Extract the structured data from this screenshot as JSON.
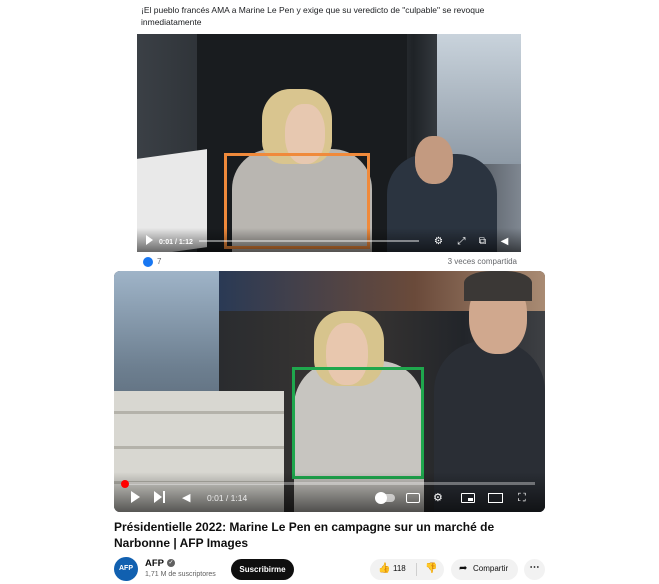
{
  "post": {
    "text": "¡El pueblo francés AMA a Marine Le Pen y exige que su veredicto de \"culpable\" se revoque inmediatamente",
    "video": {
      "time": "0:01 / 1:12",
      "progress": 0.01,
      "highlight_color": "#f08a3b"
    },
    "reactions": {
      "count": "7"
    },
    "shares": "3 veces compartida"
  },
  "youtube": {
    "player": {
      "time": "0:01 / 1:14",
      "progress": 0.01,
      "highlight_color": "#1fa74d"
    },
    "title": "Présidentielle 2022: Marine Le Pen en campagne sur un marché de Narbonne | AFP Images",
    "channel": {
      "avatar_text": "AFP",
      "name": "AFP",
      "subscribers": "1,71 M de suscriptores"
    },
    "subscribe_label": "Suscribirme",
    "likes": "118",
    "share_label": "Compartir",
    "more_label": "⋯"
  },
  "icons": {
    "play": "play-icon",
    "settings": "gear-icon",
    "fullscreen": "fullscreen-icon",
    "pip": "picture-in-picture-icon",
    "volume": "volume-icon",
    "next": "skip-next-icon",
    "captions": "captions-icon",
    "miniplayer": "miniplayer-icon",
    "theater": "theater-icon",
    "like": "thumb-up-icon",
    "dislike": "thumb-down-icon",
    "share": "share-icon",
    "verified": "verified-icon"
  },
  "colors": {
    "accent_red": "#ff0000",
    "facebook_blue": "#1877f2",
    "subscribe_bg": "#0f0f0f"
  }
}
